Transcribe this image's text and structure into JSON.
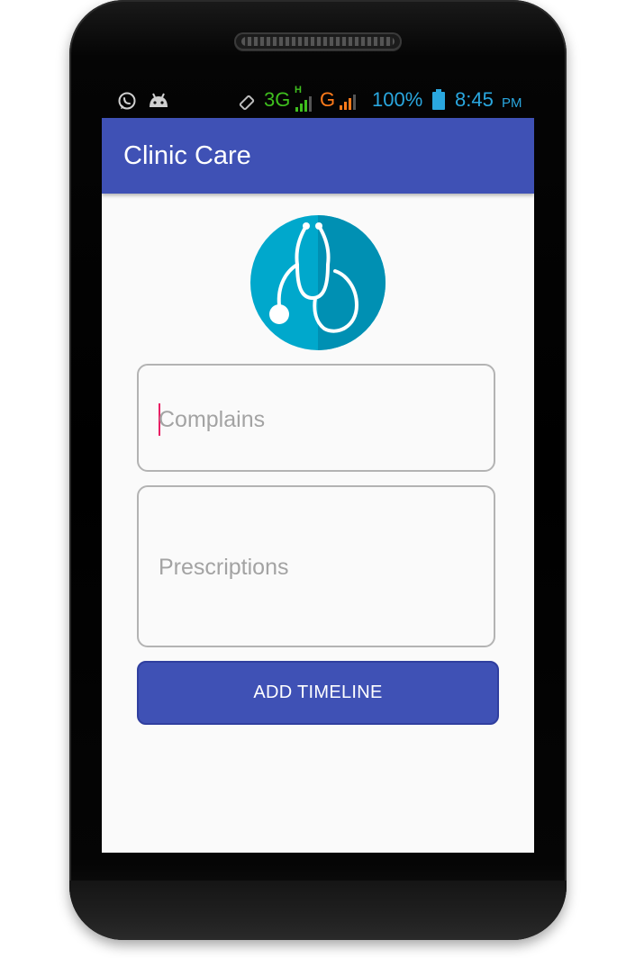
{
  "status_bar": {
    "network_3g": "3G",
    "network_h": "H",
    "network_g": "G",
    "battery": "100%",
    "time": "8:45",
    "ampm": "PM",
    "colors": {
      "green": "#3fbf1e",
      "orange": "#ff7a1a",
      "blue": "#2aa7df"
    },
    "icons": [
      "whatsapp-icon",
      "android-icon",
      "rotate-icon",
      "signal-icon",
      "battery-icon"
    ]
  },
  "app_bar": {
    "title": "Clinic Care",
    "color": "#3f51b5"
  },
  "logo": {
    "icon": "stethoscope-icon",
    "color": "#00a8cc"
  },
  "form": {
    "complains_placeholder": "Complains",
    "prescriptions_placeholder": "Prescriptions",
    "submit_label": "ADD TIMELINE",
    "accent_color": "#e91e63"
  }
}
